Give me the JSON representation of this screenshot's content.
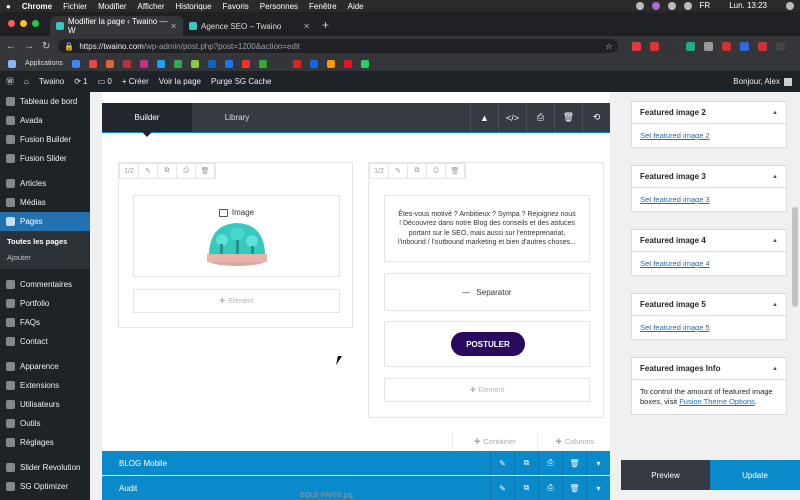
{
  "mac_menu": {
    "apple": "",
    "app": "Chrome",
    "items": [
      "Fichier",
      "Modifier",
      "Afficher",
      "Historique",
      "Favoris",
      "Personnes",
      "Fenêtre",
      "Aide"
    ],
    "lang": "FR",
    "clock": "Lun. 13:23"
  },
  "browser": {
    "tabs": [
      {
        "title": "Modifier la page ‹ Twaino — W",
        "active": true
      },
      {
        "title": "Agence SEO – Twaino",
        "active": false
      }
    ],
    "new_tab": "+",
    "url_host": "https://twaino.com",
    "url_path": "/wp-admin/post.php?post=1200&action=edit",
    "bookmark_apps": "Applications",
    "ext_colors": [
      "#e23b3b",
      "#d33",
      "#333",
      "#2a8",
      "#999",
      "#c33",
      "#2d6bd6",
      "#c33",
      "#444"
    ],
    "bookmark_colors": [
      "#4285f4",
      "#e44",
      "#d63",
      "#b33",
      "#c13584",
      "#1da1f2",
      "#3a5",
      "#8c4",
      "#0a66c2",
      "#1877f2",
      "#e33",
      "#3a3",
      "#333",
      "#d22",
      "#1266f1",
      "#f90",
      "#e12",
      "#25d366"
    ]
  },
  "adminbar": {
    "site": "Twaino",
    "updates": "1",
    "comments": "0",
    "new": "+ Créer",
    "view": "Voir la page",
    "purge": "Purge SG Cache",
    "greeting": "Bonjour, Alex"
  },
  "sidebar": {
    "items": [
      {
        "label": "Tableau de bord"
      },
      {
        "label": "Avada"
      },
      {
        "label": "Fusion Builder"
      },
      {
        "label": "Fusion Slider"
      },
      {
        "label": "Articles"
      },
      {
        "label": "Médias"
      },
      {
        "label": "Pages"
      },
      {
        "label": "Commentaires"
      },
      {
        "label": "Portfolio"
      },
      {
        "label": "FAQs"
      },
      {
        "label": "Contact"
      },
      {
        "label": "Apparence"
      },
      {
        "label": "Extensions"
      },
      {
        "label": "Utilisateurs"
      },
      {
        "label": "Outils"
      },
      {
        "label": "Réglages"
      },
      {
        "label": "Slider Revolution"
      },
      {
        "label": "SG Optimizer"
      }
    ],
    "submenu": [
      "Toutes les pages",
      "Ajouter"
    ]
  },
  "builder": {
    "tab_builder": "Builder",
    "tab_library": "Library",
    "head_icons": [
      "▲",
      "</>",
      "⎙",
      "🗑",
      "⟲"
    ],
    "col_size": "1/2",
    "col_icons": [
      "✎",
      "⧉",
      "⎙",
      "🗑"
    ],
    "image_label": "Image",
    "add_element": "Element",
    "text_block": "Êtes-vous motivé ? Ambitieux ? Sympa ? Rejoignez nous ! Découvrez dans notre Blog des conseils et des astuces portant sur le SEO, mais aussi sur l'entreprenariat, l'inbound / l'outbound marketing et bien d'autres choses...",
    "separator_label": "Separator",
    "button_label": "POSTULER",
    "add_container": "Container",
    "add_columns": "Columns",
    "rows": [
      {
        "label": "BLOG Mobile"
      },
      {
        "label": "Audit"
      }
    ]
  },
  "right_panels": [
    {
      "title": "Featured image 2",
      "link": "Set featured image 2"
    },
    {
      "title": "Featured image 3",
      "link": "Set featured image 3"
    },
    {
      "title": "Featured image 4",
      "link": "Set featured image 4"
    },
    {
      "title": "Featured image 5",
      "link": "Set featured image 5"
    }
  ],
  "info_panel": {
    "title": "Featured images Info",
    "text_before": "To control the amount of featured image boxes, visit ",
    "link": "Fusion Theme Options",
    "text_after": "."
  },
  "publish": {
    "preview": "Preview",
    "update": "Update"
  },
  "download_name": "EOLE-PARIS.jpg"
}
